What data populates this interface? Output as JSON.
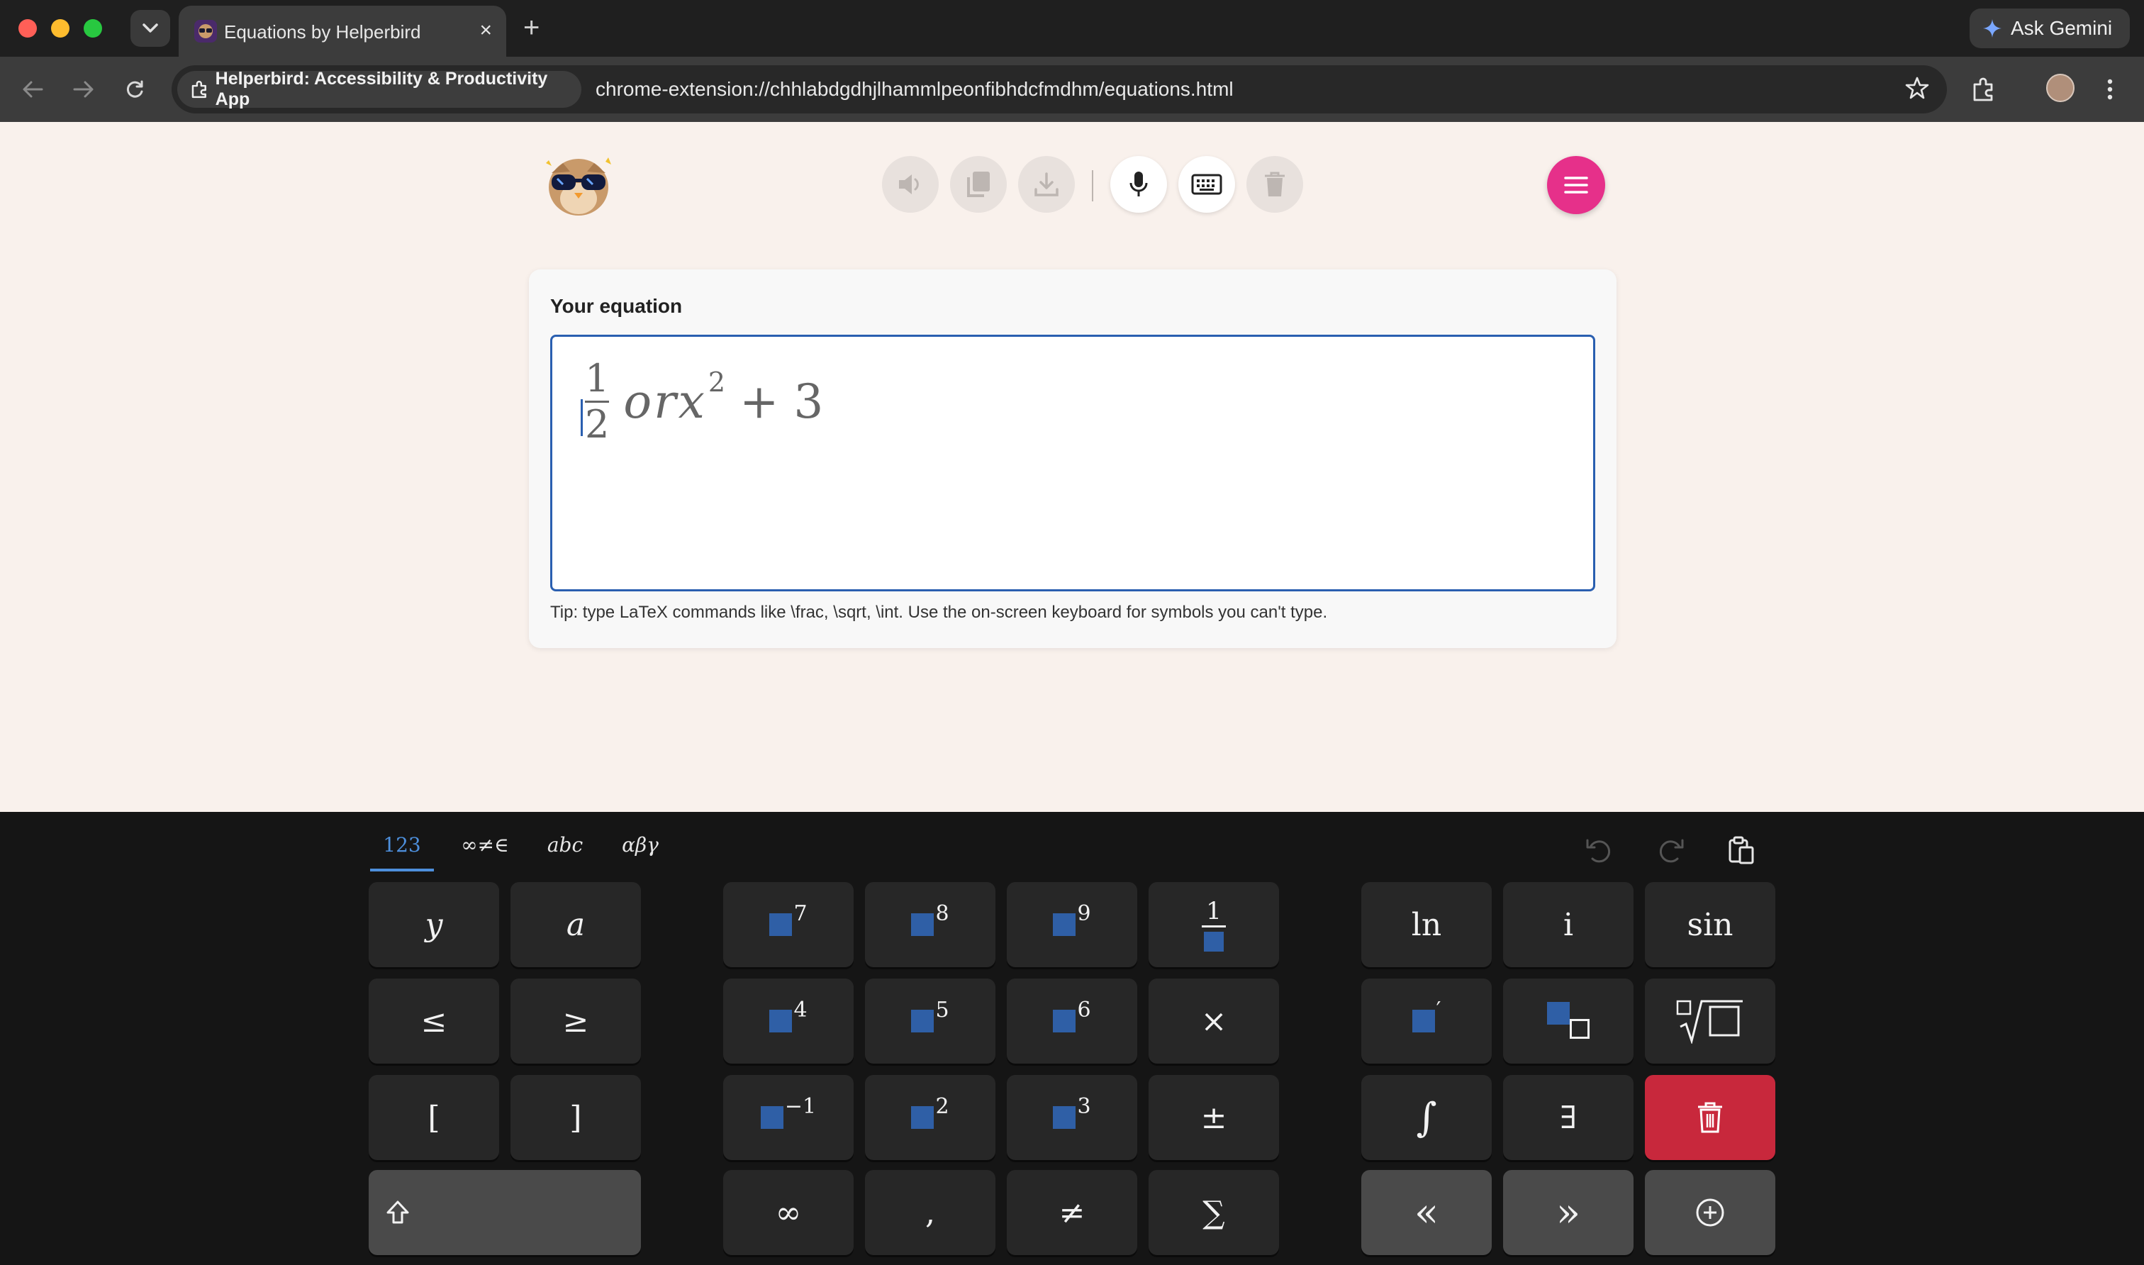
{
  "browser": {
    "tab_title": "Equations by Helperbird",
    "tab_close": "×",
    "new_tab": "+",
    "gemini_label": "Ask Gemini",
    "site_chip": "Helperbird: Accessibility & Productivity App",
    "url": "chrome-extension://chhlabdgdhjlhammlpeonfibhdcfmdhm/equations.html"
  },
  "app": {
    "card_title": "Your equation",
    "equation": {
      "frac_num": "1",
      "frac_den": "2",
      "text": "orx",
      "sup": "2",
      "rest": "+ 3"
    },
    "tip": "Tip: type LaTeX commands like \\frac, \\sqrt, \\int. Use the on-screen keyboard for symbols you can't type."
  },
  "keyboard": {
    "tabs": [
      "123",
      "∞≠∈",
      "abc",
      "αβγ"
    ],
    "active_tab": "123",
    "keys": {
      "y": "y",
      "a": "a",
      "le": "≤",
      "ge": "≥",
      "lbracket": "[",
      "rbracket": "]",
      "p7": "7",
      "p8": "8",
      "p9": "9",
      "frac_num": "1",
      "p4": "4",
      "p5": "5",
      "p6": "6",
      "times": "×",
      "pinv": "−1",
      "p2": "2",
      "p3": "3",
      "pm": "±",
      "inf": "∞",
      "comma": ",",
      "neq": "≠",
      "sum": "∑",
      "ln": "ln",
      "i": "i",
      "sin": "sin",
      "prime": "′",
      "exists": "∃",
      "integral": "∫",
      "left": "«",
      "right": "»"
    }
  },
  "colors": {
    "accent_pink": "#e6308a",
    "focus_blue": "#2a5fb0",
    "placeholder_blue": "#2f5fa6",
    "delete_red": "#c8283c"
  }
}
